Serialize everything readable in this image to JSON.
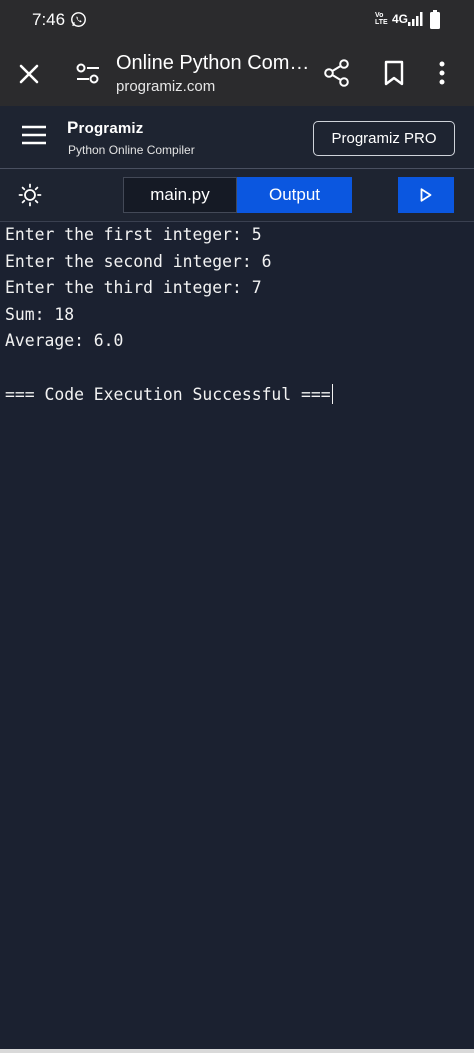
{
  "status_bar": {
    "time": "7:46",
    "network_volte": "Vo\nLTE",
    "network_type": "4G",
    "icons": [
      "whatsapp-icon",
      "signal-icon",
      "battery-icon"
    ]
  },
  "browser": {
    "title": "Online Python Comp...",
    "url": "programiz.com"
  },
  "site": {
    "logo": "Programiz",
    "subtitle": "Python Online Compiler",
    "pro_button": "Programiz PRO"
  },
  "toolbar": {
    "tabs": [
      {
        "label": "main.py",
        "active": false
      },
      {
        "label": "Output",
        "active": true
      }
    ]
  },
  "console": {
    "lines": [
      "Enter the first integer: 5",
      "Enter the second integer: 6",
      "Enter the third integer: 7",
      "Sum: 18",
      "Average: 6.0",
      "",
      "=== Code Execution Successful ==="
    ]
  },
  "colors": {
    "accent": "#0b57e0",
    "background": "#1b2130",
    "header": "#1e2431",
    "browser_bar": "#2b2b2d"
  }
}
